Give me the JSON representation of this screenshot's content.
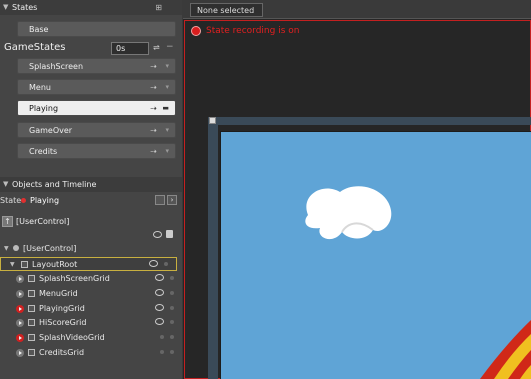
{
  "states_panel": {
    "title": "States",
    "base_label": "Base",
    "group_name": "GameStates",
    "transition_time": "0s",
    "states": [
      {
        "label": "SplashScreen",
        "selected": false
      },
      {
        "label": "Menu",
        "selected": false
      },
      {
        "label": "Playing",
        "selected": true
      },
      {
        "label": "GameOver",
        "selected": false
      },
      {
        "label": "Credits",
        "selected": false
      }
    ]
  },
  "objects_panel": {
    "title": "Objects and Timeline",
    "state_prefix": "State",
    "state_value": "Playing",
    "scope_label": "[UserControl]",
    "tree": [
      {
        "label": "[UserControl]"
      },
      {
        "label": "LayoutRoot"
      },
      {
        "label": "SplashScreenGrid"
      },
      {
        "label": "MenuGrid"
      },
      {
        "label": "PlayingGrid"
      },
      {
        "label": "HiScoreGrid"
      },
      {
        "label": "SplashVideoGrid"
      },
      {
        "label": "CreditsGrid"
      }
    ]
  },
  "artboard": {
    "tab_label": "None selected",
    "recording_text": "State recording is on",
    "colors": {
      "recording": "#d81e1e",
      "sky": "#5fa4d6"
    }
  }
}
